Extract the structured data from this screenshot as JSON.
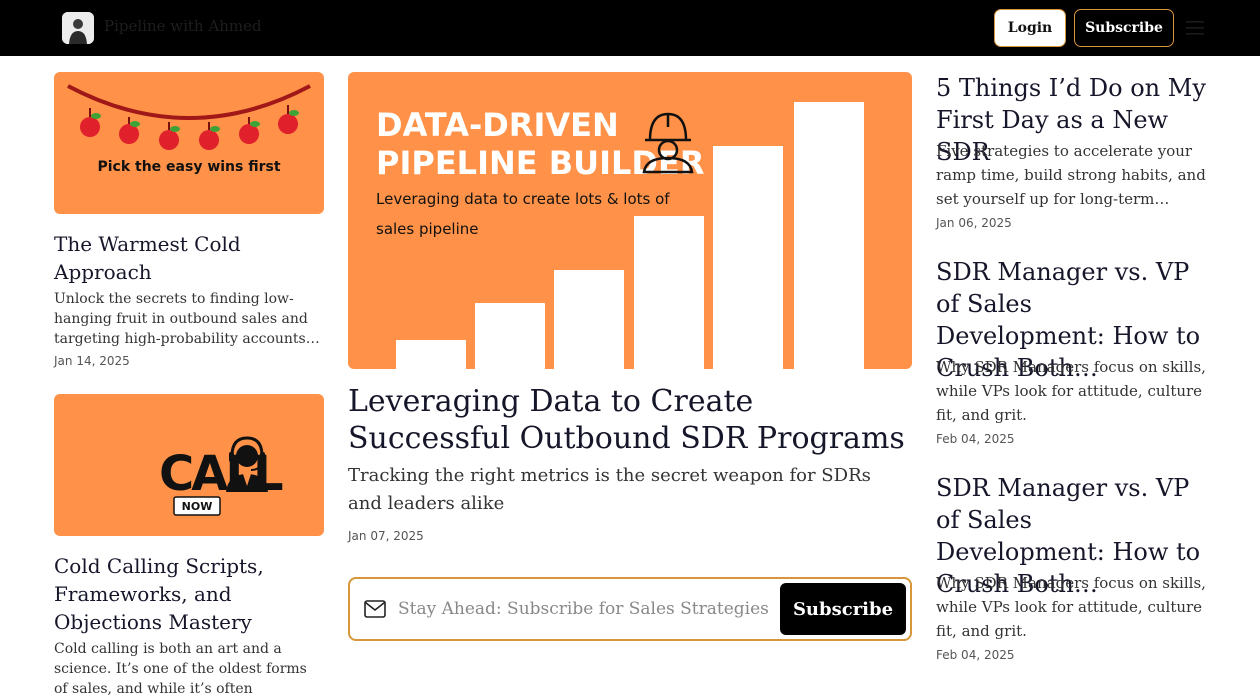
{
  "header": {
    "site_name": "Pipeline with Ahmed",
    "login_label": "Login",
    "subscribe_label": "Subscribe",
    "menu_icon": "hamburger-menu-icon"
  },
  "left_posts": [
    {
      "image_caption": "Pick the easy wins first",
      "title": "The Warmest Cold Approach",
      "excerpt": "Unlock the secrets to finding low-hanging fruit in outbound sales and targeting high-probability accounts…",
      "date": "Jan 14, 2025"
    },
    {
      "image_text_main": "CALL",
      "image_text_badge": "NOW",
      "title": "Cold Calling Scripts, Frameworks, and Objections Mastery",
      "excerpt": "Cold calling is both an art and a science. It’s one of the oldest forms of sales, and while it’s often considered the toughes…",
      "date": ""
    }
  ],
  "feature": {
    "image_title_line1": "DATA-DRIVEN",
    "image_title_line2": "PIPELINE BUILDER",
    "image_sub_line1": "Leveraging data to create lots & lots of",
    "image_sub_line2": "sales pipeline",
    "title": "Leveraging Data to Create Successful Outbound SDR Programs",
    "subtitle": "Tracking the right metrics is the secret weapon for SDRs and leaders alike",
    "date": "Jan 07, 2025"
  },
  "subscribe_form": {
    "placeholder": "Stay Ahead: Subscribe for Sales Strategies",
    "button_label": "Subscribe"
  },
  "right_posts": [
    {
      "title": "5 Things I’d Do on My First Day as a New SDR",
      "excerpt": "Five strategies to accelerate your ramp time, build strong habits, and set yourself up for long-term…",
      "date": "Jan 06, 2025"
    },
    {
      "title": "SDR Manager vs. VP of Sales Development: How to Crush Both…",
      "excerpt": "Why SDR Managers focus on skills, while VPs look for attitude, culture fit, and grit.",
      "date": "Feb 04, 2025"
    },
    {
      "title": "SDR Manager vs. VP of Sales Development: How to Crush Both…",
      "excerpt": "Why SDR Managers focus on skills, while VPs look for attitude, culture fit, and grit.",
      "date": "Feb 04, 2025"
    }
  ],
  "colors": {
    "header_bg": "#000000",
    "card_orange": "#ff9248",
    "accent_border": "#d7963a",
    "apple_red": "#e0202a",
    "bar_white": "#ffffff"
  }
}
